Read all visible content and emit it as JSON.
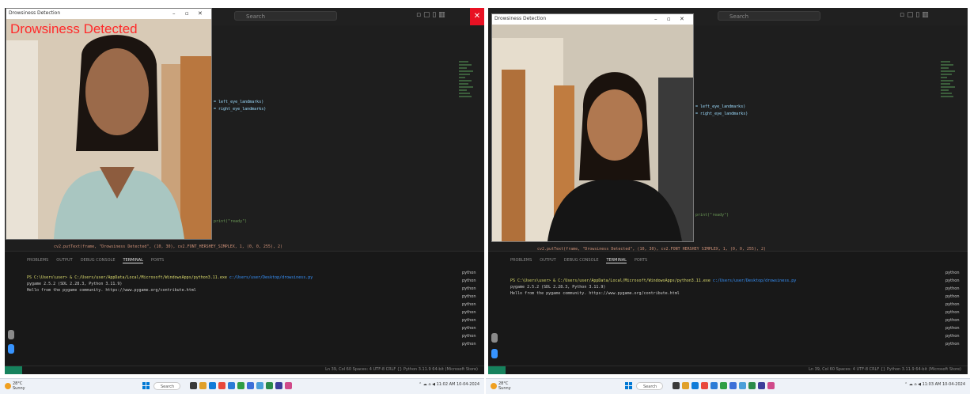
{
  "left": {
    "camera": {
      "window_title": "Drowsiness Detection",
      "overlay_text": "Drowsiness Detected"
    },
    "vscode": {
      "search": "Search",
      "code_lines": [
        "= left_eye_landmarks)",
        "= right_eye_landmarks)",
        "print(\"ready\")"
      ],
      "status_line": "cv2.putText(frame, \"Drowsiness Detected\", (10, 30), cv2.FONT_HERSHEY_SIMPLEX, 1, (0, 0, 255), 2)",
      "terminal_tabs": [
        "PROBLEMS",
        "OUTPUT",
        "DEBUG CONSOLE",
        "TERMINAL",
        "PORTS"
      ],
      "terminal_lines": [
        {
          "text": "PS C:\\Users\\user> & C:/Users/user/AppData/Local/Microsoft/WindowsApps/python3.11.exe",
          "tail": "c:/Users/user/Desktop/drowsiness.py"
        },
        {
          "text": "pygame 2.5.2 (SDL 2.28.3, Python 3.11.9)"
        },
        {
          "text": "Hello from the pygame community. https://www.pygame.org/contribute.html"
        }
      ],
      "shells": [
        "python",
        "python",
        "python",
        "python",
        "python",
        "python",
        "python",
        "python",
        "python",
        "python"
      ],
      "status_right": "Ln 39, Col 60   Spaces: 4   UTF-8   CRLF   {} Python   3.11.9 64-bit (Microsoft Store)"
    },
    "taskbar": {
      "weather": "28°C Sunny",
      "search": "Search",
      "time": "11:02 AM",
      "date": "10-04-2024"
    }
  },
  "right": {
    "camera": {
      "window_title": "Drowsiness Detection"
    },
    "vscode": {
      "search": "Search",
      "code_lines": [
        "= left_eye_landmarks)",
        "= right_eye_landmarks)",
        "print(\"ready\")"
      ],
      "status_line": "cv2.putText(frame, \"Drowsiness Detected\", (10, 30), cv2.FONT_HERSHEY_SIMPLEX, 1, (0, 0, 255), 2)",
      "terminal_tabs": [
        "PROBLEMS",
        "OUTPUT",
        "DEBUG CONSOLE",
        "TERMINAL",
        "PORTS"
      ],
      "terminal_lines": [
        {
          "text": "PS C:\\Users\\user> & C:/Users/user/AppData/Local/Microsoft/WindowsApps/python3.11.exe",
          "tail": "c:/Users/user/Desktop/drowsiness.py"
        },
        {
          "text": "pygame 2.5.2 (SDL 2.28.3, Python 3.11.9)"
        },
        {
          "text": "Hello from the pygame community. https://www.pygame.org/contribute.html"
        }
      ],
      "shells": [
        "python",
        "python",
        "python",
        "python",
        "python",
        "python",
        "python",
        "python",
        "python",
        "python"
      ],
      "status_right": "Ln 39, Col 60   Spaces: 4   UTF-8   CRLF   {} Python   3.11.9 64-bit (Microsoft Store)"
    },
    "taskbar": {
      "weather": "28°C Sunny",
      "search": "Search",
      "time": "11:03 AM",
      "date": "10-04-2024"
    }
  },
  "colors": {
    "overlay_red": "#ff2a2a",
    "vscode_bg": "#1e1e1e",
    "close_red": "#e81123",
    "remote_green": "#16825d"
  }
}
